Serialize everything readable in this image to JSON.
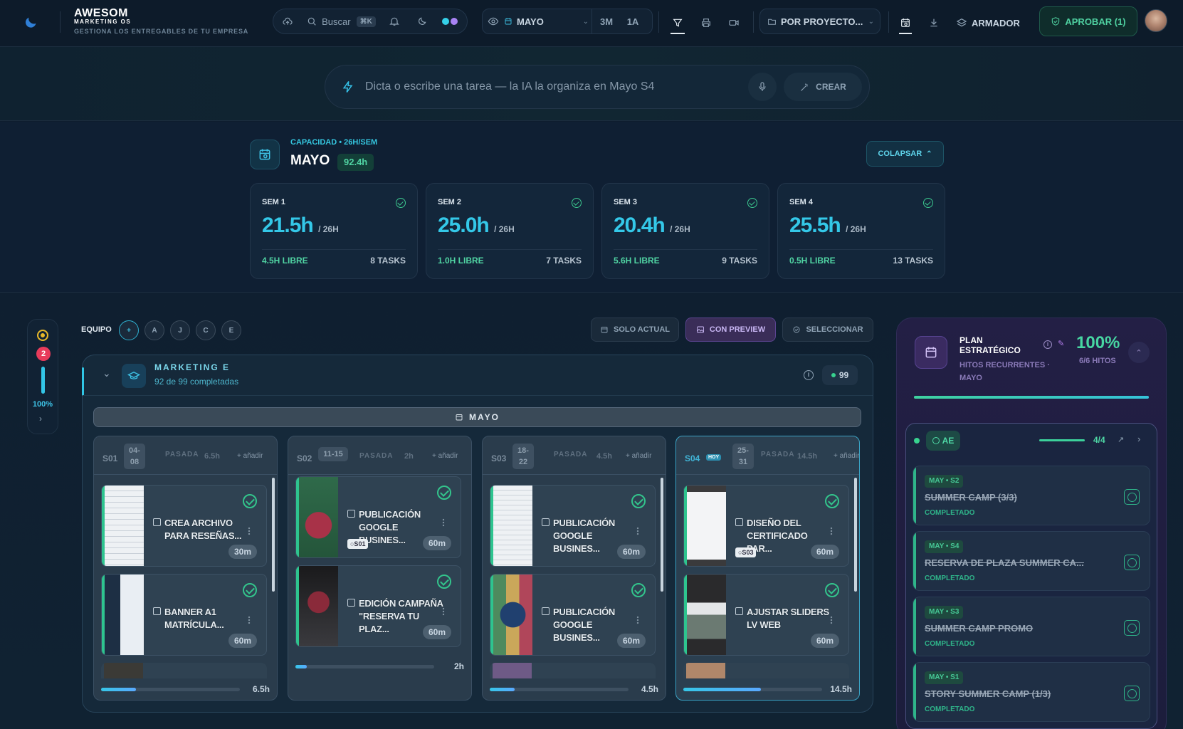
{
  "header": {
    "brand_title": "AWESOM",
    "brand_sub": "MARKETING OS",
    "brand_tagline": "GESTIONA LOS ENTREGABLES DE TU EMPRESA",
    "search_label": "Buscar",
    "search_shortcut": "⌘K",
    "month": "MAYO",
    "range_3m": "3M",
    "range_1a": "1A",
    "project_filter": "POR PROYECTO...",
    "armador": "ARMADOR",
    "approve": "APROBAR (1)"
  },
  "ai": {
    "placeholder": "Dicta o escribe una tarea — la IA la organiza en Mayo S4",
    "create": "CREAR"
  },
  "capacity": {
    "label": "CAPACIDAD • 26H/SEM",
    "month": "MAYO",
    "total": "92.4h",
    "collapse": "COLAPSAR",
    "weeks": [
      {
        "title": "SEM 1",
        "hours": "21.5h",
        "cap": "/ 26H",
        "free": "4.5H LIBRE",
        "tasks": "8 TASKS"
      },
      {
        "title": "SEM 2",
        "hours": "25.0h",
        "cap": "/ 26H",
        "free": "1.0H LIBRE",
        "tasks": "7 TASKS"
      },
      {
        "title": "SEM 3",
        "hours": "20.4h",
        "cap": "/ 26H",
        "free": "5.6H LIBRE",
        "tasks": "9 TASKS"
      },
      {
        "title": "SEM 4",
        "hours": "25.5h",
        "cap": "/ 26H",
        "free": "0.5H LIBRE",
        "tasks": "13 TASKS"
      }
    ]
  },
  "mini": {
    "badge": "2",
    "pct": "100%",
    "level": 1.0
  },
  "team": {
    "label": "EQUIPO",
    "members": [
      "+",
      "A",
      "J",
      "C",
      "E"
    ],
    "solo_actual": "SOLO ACTUAL",
    "con_preview": "CON PREVIEW",
    "seleccionar": "SELECCIONAR"
  },
  "board": {
    "title": "MARKETING E",
    "subtitle": "92 de 99 completadas",
    "count": "99",
    "month_bar": "MAYO",
    "weeks": [
      {
        "label": "S01",
        "date_top": "04-",
        "date_bottom": "08",
        "status": "PASADA",
        "hours": "6.5h",
        "add": "+ añadir",
        "progress": 0.25,
        "total": "6.5h",
        "cards": [
          {
            "title": "CREA ARCHIVO PARA RESEÑAS...",
            "duration": "30m",
            "tag": ""
          },
          {
            "title": "BANNER A1 MATRÍCULA...",
            "duration": "60m",
            "tag": ""
          }
        ]
      },
      {
        "label": "S02",
        "date_range": "11-15",
        "status": "PASADA",
        "hours": "2h",
        "add": "+ añadir",
        "progress": 0.08,
        "total": "2h",
        "cards": [
          {
            "title": "PUBLICACIÓN GOOGLE BUSINES...",
            "duration": "60m",
            "tag": "S01"
          },
          {
            "title": "EDICIÓN CAMPAÑA \"RESERVA TU PLAZ...",
            "duration": "60m",
            "tag": ""
          }
        ]
      },
      {
        "label": "S03",
        "date_top": "18-",
        "date_bottom": "22",
        "status": "PASADA",
        "hours": "4.5h",
        "add": "+ añadir",
        "progress": 0.18,
        "total": "4.5h",
        "cards": [
          {
            "title": "PUBLICACIÓN GOOGLE BUSINES...",
            "duration": "60m",
            "tag": ""
          },
          {
            "title": "PUBLICACIÓN GOOGLE BUSINES...",
            "duration": "60m",
            "tag": ""
          }
        ]
      },
      {
        "label": "S04",
        "hoy": "HOY",
        "date_top": "25-",
        "date_bottom": "31",
        "status": "PASADA",
        "hours": "14.5h",
        "add": "+ añadir",
        "progress": 0.56,
        "total": "14.5h",
        "cards": [
          {
            "title": "DISEÑO DEL CERTIFICADO PAR...",
            "duration": "60m",
            "tag": "S03"
          },
          {
            "title": "AJUSTAR SLIDERS LV WEB",
            "duration": "60m",
            "tag": ""
          }
        ]
      }
    ]
  },
  "plan": {
    "title": "PLAN ESTRATÉGICO",
    "subtitle": "HITOS RECURRENTES · MAYO",
    "pct": "100%",
    "hitos": "6/6 HITOS",
    "progress": 1.0,
    "ae": {
      "label": "AE",
      "count": "4/4"
    },
    "milestones": [
      {
        "tag": "MAY • S2",
        "title": "SUMMER CAMP (3/3)",
        "status": "COMPLETADO"
      },
      {
        "tag": "MAY • S4",
        "title": "RESERVA DE PLAZA SUMMER CA...",
        "status": "COMPLETADO"
      },
      {
        "tag": "MAY • S3",
        "title": "SUMMER CAMP PROMO",
        "status": "COMPLETADO"
      },
      {
        "tag": "MAY • S1",
        "title": "STORY SUMMER CAMP (1/3)",
        "status": "COMPLETADO"
      }
    ]
  }
}
